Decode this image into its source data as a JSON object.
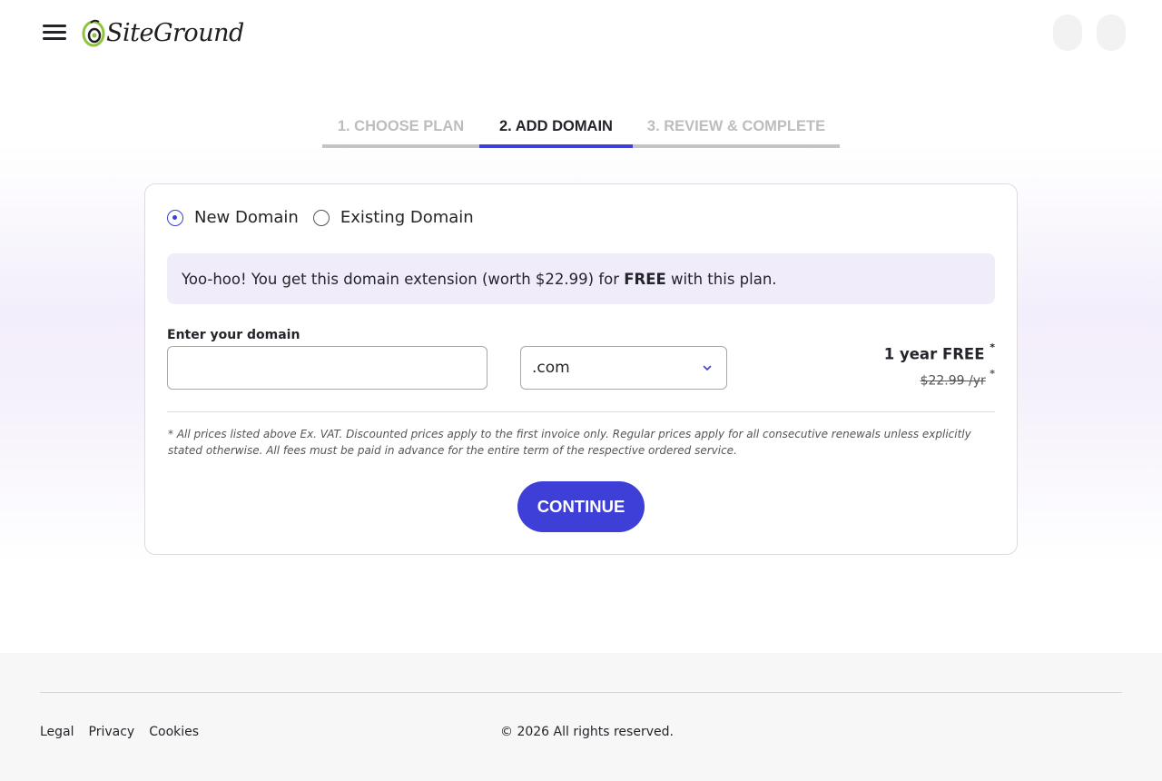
{
  "header": {
    "logo_text": "SiteGround"
  },
  "steps": [
    {
      "label": "1. Choose Plan",
      "state": "done"
    },
    {
      "label": "2. Add Domain",
      "state": "active"
    },
    {
      "label": "3. Review & Complete",
      "state": "pending"
    }
  ],
  "domain_type": {
    "options": [
      {
        "label": "New Domain",
        "selected": true
      },
      {
        "label": "Existing Domain",
        "selected": false
      }
    ]
  },
  "promo": {
    "text_before": "Yoo-hoo! You get this domain extension (worth $22.99) for ",
    "text_bold": "FREE",
    "text_after": " with this plan."
  },
  "domain_form": {
    "label": "Enter your domain",
    "input_value": "",
    "input_placeholder": "",
    "tld_selected": ".com"
  },
  "pricing": {
    "free_label": "1 year FREE",
    "old_price": "$22.99 /yr",
    "asterisk": "*"
  },
  "note": "* All prices listed above Ex. VAT. Discounted prices apply to the first invoice only. Regular prices apply for all consecutive renewals unless explicitly stated otherwise. All fees must be paid in advance for the entire term of the respective ordered service.",
  "continue_label": "Continue",
  "footer": {
    "links": [
      "Legal",
      "Privacy",
      "Cookies"
    ],
    "copyright": "© 2026 All rights reserved."
  },
  "colors": {
    "accent": "#3d3fd6",
    "promo_bg": "#f1ecfa",
    "footer_bg": "#f7f7f7",
    "logo_green": "#8fc33f"
  }
}
